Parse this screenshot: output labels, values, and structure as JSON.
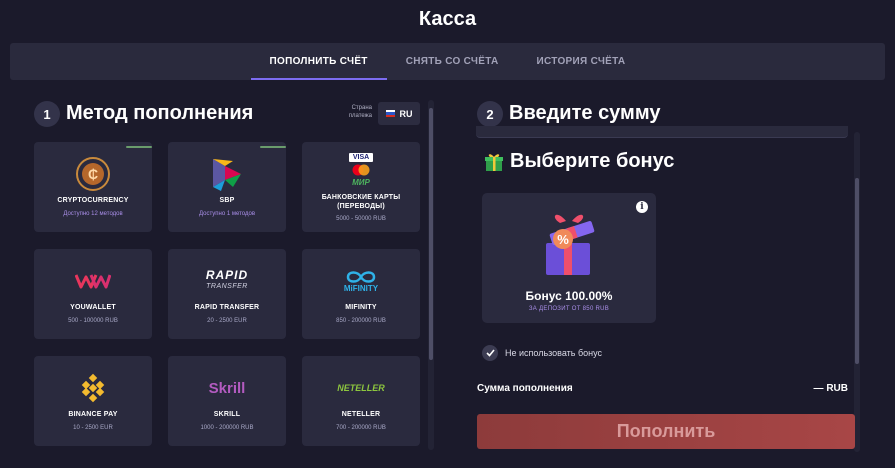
{
  "page": {
    "title": "Касса"
  },
  "tabs": [
    {
      "label": "ПОПОЛНИТЬ СЧЁТ",
      "active": true
    },
    {
      "label": "СНЯТЬ СО СЧЁТА",
      "active": false
    },
    {
      "label": "ИСТОРИЯ СЧЁТА",
      "active": false
    }
  ],
  "left": {
    "step": "1",
    "title": "Метод пополнения",
    "country_label_1": "Страна",
    "country_label_2": "платежа",
    "country_code": "RU",
    "methods": [
      {
        "name": "CRYPTOCURRENCY",
        "sub": "Доступно 12 методов",
        "icon": "cryptocurrency-icon"
      },
      {
        "name": "SBP",
        "sub": "Доступно 1 методов",
        "icon": "sbp-icon"
      },
      {
        "name_1": "БАНКОВСКИЕ КАРТЫ",
        "name_2": "(ПЕРЕВОДЫ)",
        "sub": "5000 - 50000 RUB",
        "icon": "bank-cards-icon",
        "visa": "VISA",
        "mir": "МИР"
      },
      {
        "name": "YOUWALLET",
        "sub": "500 - 100000 RUB",
        "icon": "youwallet-icon"
      },
      {
        "name": "RAPID TRANSFER",
        "sub": "20 - 2500 EUR",
        "icon": "rapid-transfer-icon",
        "logo_1": "RAPID",
        "logo_2": "TRANSFER"
      },
      {
        "name": "MIFINITY",
        "sub": "850 - 200000 RUB",
        "icon": "mifinity-icon",
        "logo": "MiFINITY"
      },
      {
        "name": "BINANCE PAY",
        "sub": "10 - 2500 EUR",
        "icon": "binance-icon"
      },
      {
        "name": "SKRILL",
        "sub": "1000 - 200000 RUB",
        "icon": "skrill-icon",
        "logo": "Skrill"
      },
      {
        "name": "NETELLER",
        "sub": "700 - 200000 RUB",
        "icon": "neteller-icon",
        "logo": "NETELLER"
      }
    ]
  },
  "right": {
    "step": "2",
    "title": "Введите сумму",
    "bonus_title": "Выберите бонус",
    "bonus": {
      "label": "Бонус 100.00%",
      "sub": "ЗА ДЕПОЗИТ ОТ 850 RUB",
      "info": "i",
      "gift_text": "%"
    },
    "no_bonus_label": "Не использовать бонус",
    "amount_label": "Сумма пополнения",
    "amount_value": "— RUB",
    "submit_label": "Пополнить"
  },
  "colors": {
    "accent": "#7c6cf0",
    "submit": "#a84646",
    "background": "#1b1a2b",
    "card": "#2a2a3e"
  }
}
